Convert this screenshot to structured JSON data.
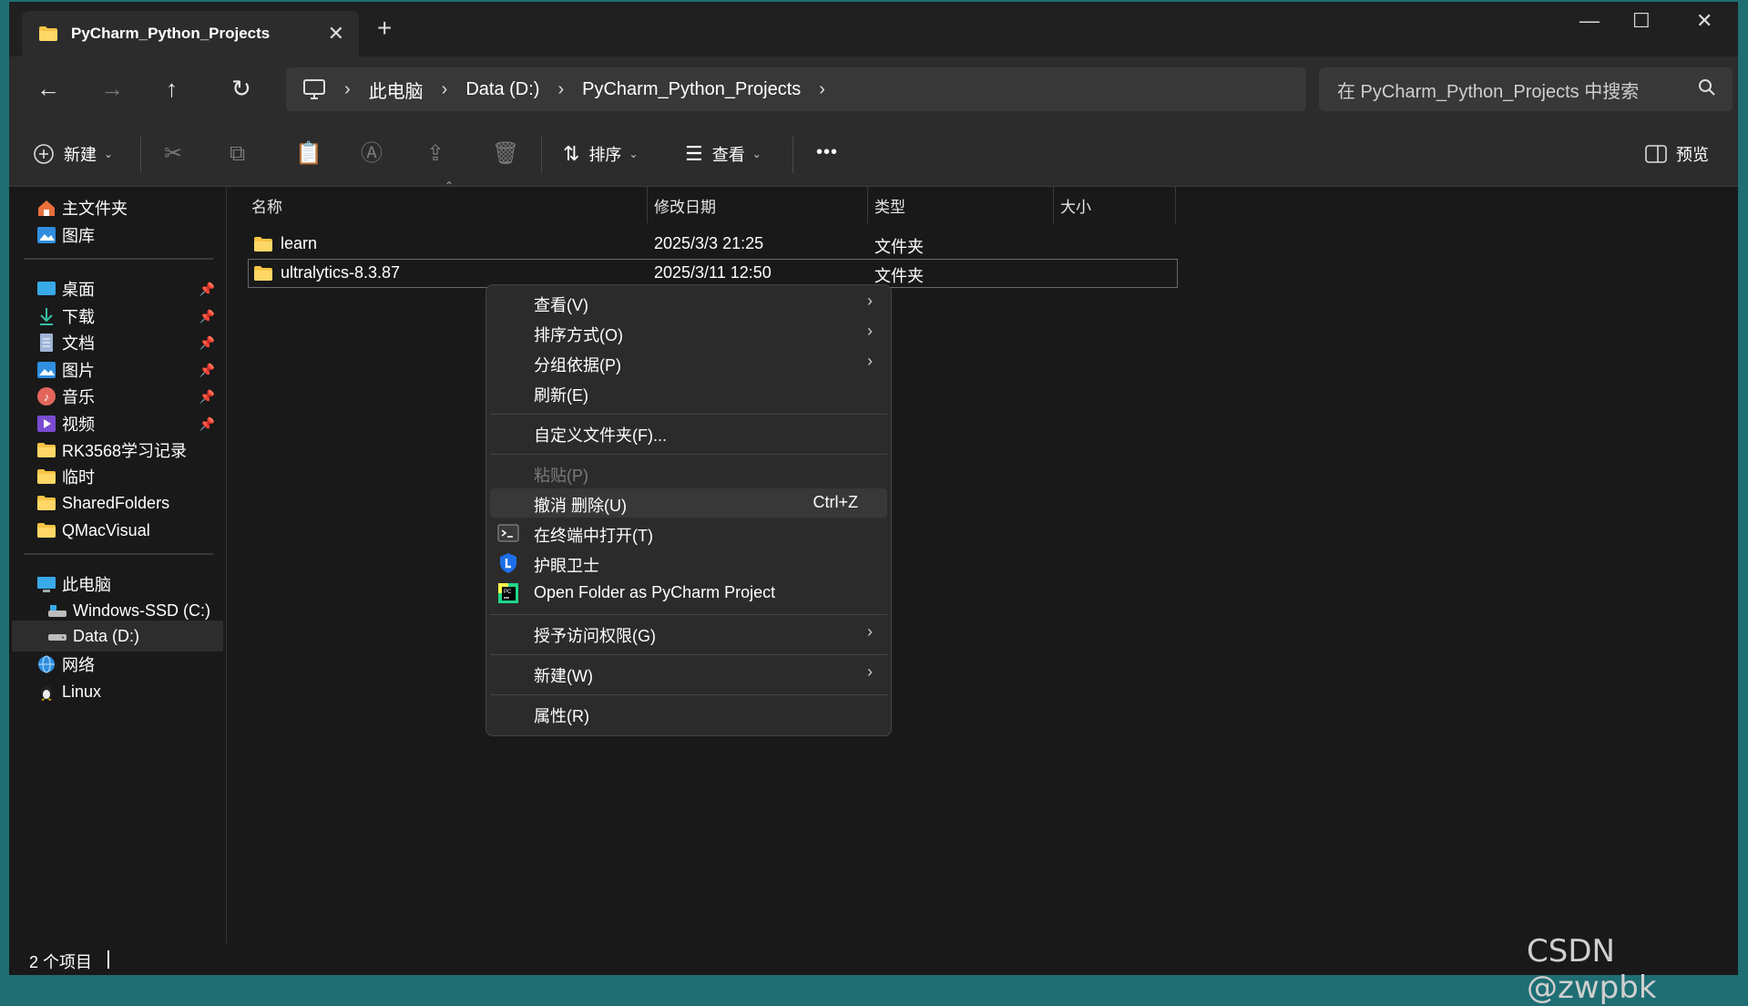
{
  "window": {
    "tab_title": "PyCharm_Python_Projects",
    "new_tab": "+",
    "controls": {
      "minimize": "—",
      "maximize": "☐",
      "close": "✕"
    }
  },
  "navigation": {
    "back": "←",
    "forward": "→",
    "up": "↑",
    "refresh": "↻",
    "breadcrumbs": [
      "此电脑",
      "Data (D:)",
      "PyCharm_Python_Projects"
    ],
    "search_placeholder": "在 PyCharm_Python_Projects 中搜索"
  },
  "toolbar": {
    "new_label": "新建",
    "sort_label": "排序",
    "view_label": "查看",
    "more": "•••",
    "preview_label": "预览"
  },
  "sidebar": {
    "quick": [
      {
        "label": "主文件夹",
        "icon": "home-icon"
      },
      {
        "label": "图库",
        "icon": "gallery-icon"
      }
    ],
    "pinned": [
      {
        "label": "桌面",
        "icon": "desktop-icon",
        "pinned": true
      },
      {
        "label": "下载",
        "icon": "download-icon",
        "pinned": true
      },
      {
        "label": "文档",
        "icon": "document-icon",
        "pinned": true
      },
      {
        "label": "图片",
        "icon": "pictures-icon",
        "pinned": true
      },
      {
        "label": "音乐",
        "icon": "music-icon",
        "pinned": true
      },
      {
        "label": "视频",
        "icon": "video-icon",
        "pinned": true
      },
      {
        "label": "RK3568学习记录",
        "icon": "folder-icon"
      },
      {
        "label": "临时",
        "icon": "folder-icon"
      },
      {
        "label": "SharedFolders",
        "icon": "folder-icon"
      },
      {
        "label": "QMacVisual",
        "icon": "folder-icon"
      }
    ],
    "devices": [
      {
        "label": "此电脑",
        "icon": "this-pc-icon"
      },
      {
        "label": "Windows-SSD (C:)",
        "icon": "drive-c-icon"
      },
      {
        "label": "Data (D:)",
        "icon": "drive-d-icon",
        "selected": true
      },
      {
        "label": "网络",
        "icon": "network-icon"
      },
      {
        "label": "Linux",
        "icon": "linux-icon"
      }
    ]
  },
  "file_list": {
    "columns": [
      "名称",
      "修改日期",
      "类型",
      "大小"
    ],
    "rows": [
      {
        "name": "learn",
        "date": "2025/3/3 21:25",
        "type": "文件夹",
        "size": ""
      },
      {
        "name": "ultralytics-8.3.87",
        "date": "2025/3/11 12:50",
        "type": "文件夹",
        "size": "",
        "selected": true
      }
    ]
  },
  "context_menu": {
    "items": [
      {
        "label": "查看(V)",
        "submenu": true
      },
      {
        "label": "排序方式(O)",
        "submenu": true
      },
      {
        "label": "分组依据(P)",
        "submenu": true
      },
      {
        "label": "刷新(E)"
      },
      {
        "label": "自定义文件夹(F)..."
      },
      {
        "label": "粘贴(P)",
        "disabled": true
      },
      {
        "label": "撤消 删除(U)",
        "shortcut": "Ctrl+Z",
        "highlighted": true
      },
      {
        "label": "在终端中打开(T)",
        "icon": "terminal-icon"
      },
      {
        "label": "护眼卫士",
        "icon": "shield-icon"
      },
      {
        "label": "Open Folder as PyCharm Project",
        "icon": "pycharm-icon"
      },
      {
        "label": "授予访问权限(G)",
        "submenu": true
      },
      {
        "label": "新建(W)",
        "submenu": true
      },
      {
        "label": "属性(R)"
      }
    ]
  },
  "status": {
    "count": "2 个项目"
  },
  "watermark": "CSDN @zwpbk",
  "colors": {
    "accent": "#0078d4",
    "folder": "#f6c445",
    "background": "#191919",
    "surface": "#2c2c2c"
  }
}
